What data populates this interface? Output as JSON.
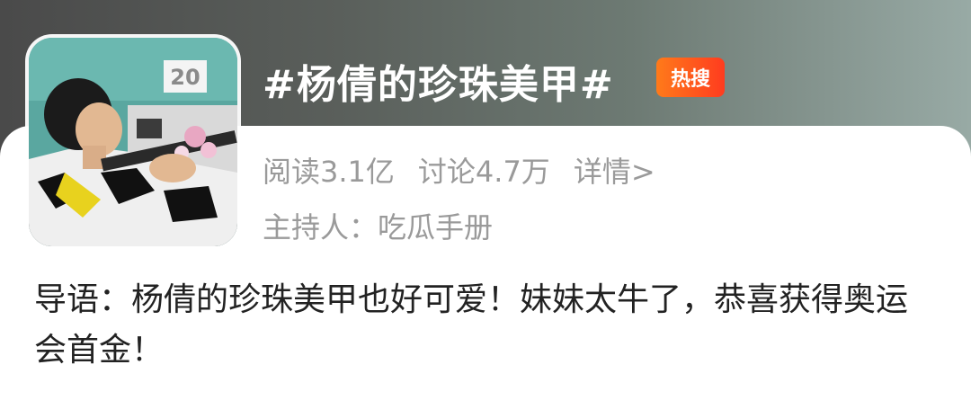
{
  "topic": {
    "title": "#杨倩的珍珠美甲#",
    "badge": "热搜"
  },
  "stats": {
    "reads": "阅读3.1亿",
    "discussions": "讨论4.7万",
    "detail_link": "详情>"
  },
  "host": "主持人：吃瓜手册",
  "lead": "导语：杨倩的珍珠美甲也好可爱！妹妹太牛了，恭喜获得奥运会首金！",
  "thumbnail": {
    "sign_text": "20"
  },
  "colors": {
    "badge": "#ff5a1f",
    "muted_text": "#9a9a9a",
    "body_text": "#222222"
  }
}
